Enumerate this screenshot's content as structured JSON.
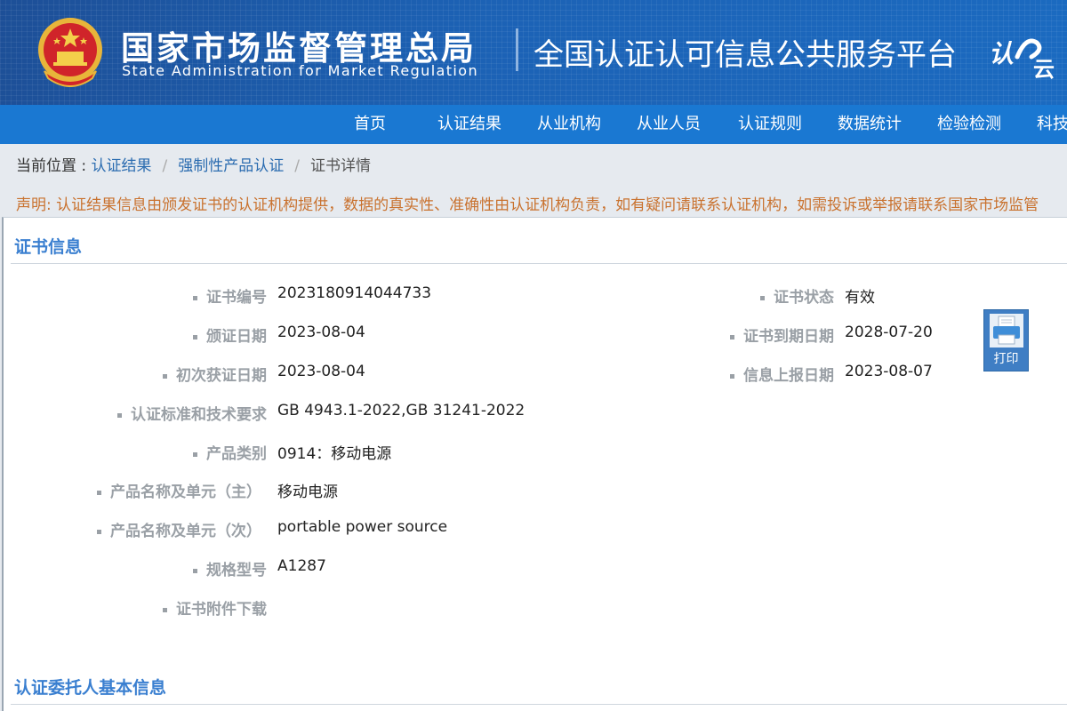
{
  "header": {
    "agency_cn": "国家市场监督管理总局",
    "agency_en": "State Administration  for  Market Regulation",
    "platform": "全国认证认可信息公共服务平台",
    "logo_text_1": "认",
    "logo_text_2": "云"
  },
  "nav": {
    "items": [
      {
        "label": "首页"
      },
      {
        "label": "认证结果"
      },
      {
        "label": "从业机构"
      },
      {
        "label": "从业人员"
      },
      {
        "label": "认证规则"
      },
      {
        "label": "数据统计"
      },
      {
        "label": "检验检测"
      },
      {
        "label": "科技"
      }
    ]
  },
  "breadcrumb": {
    "prefix": "当前位置 : ",
    "items": [
      "认证结果",
      "强制性产品认证"
    ],
    "current": "证书详情",
    "sep": "/"
  },
  "notice": "声明: 认证结果信息由颁发证书的认证机构提供，数据的真实性、准确性由认证机构负责，如有疑问请联系认证机构，如需投诉或举报请联系国家市场监管",
  "certificate": {
    "section_title": "证书信息",
    "left_fields": [
      {
        "label": "证书编号",
        "value": "2023180914044733"
      },
      {
        "label": "颁证日期",
        "value": "2023-08-04"
      },
      {
        "label": "初次获证日期",
        "value": "2023-08-04"
      },
      {
        "label": "认证标准和技术要求",
        "value": "GB 4943.1-2022,GB 31241-2022"
      },
      {
        "label": "产品类别",
        "value": "0914：移动电源"
      },
      {
        "label": "产品名称及单元（主）",
        "value": "移动电源"
      },
      {
        "label": "产品名称及单元（次）",
        "value": "portable power source"
      },
      {
        "label": "规格型号",
        "value": "A1287"
      },
      {
        "label": "证书附件下载",
        "value": ""
      }
    ],
    "right_fields": [
      {
        "label": "证书状态",
        "value": "有效"
      },
      {
        "label": "证书到期日期",
        "value": "2028-07-20"
      },
      {
        "label": "信息上报日期",
        "value": "2023-08-07"
      }
    ],
    "print_label": "打印"
  },
  "applicant": {
    "section_title": "认证委托人基本信息"
  },
  "colors": {
    "header_bg": "#1a5aa6",
    "nav_bg": "#1a78d2",
    "section_title": "#3a7fd0",
    "notice": "#c9722f",
    "link": "#2b6cb0"
  }
}
